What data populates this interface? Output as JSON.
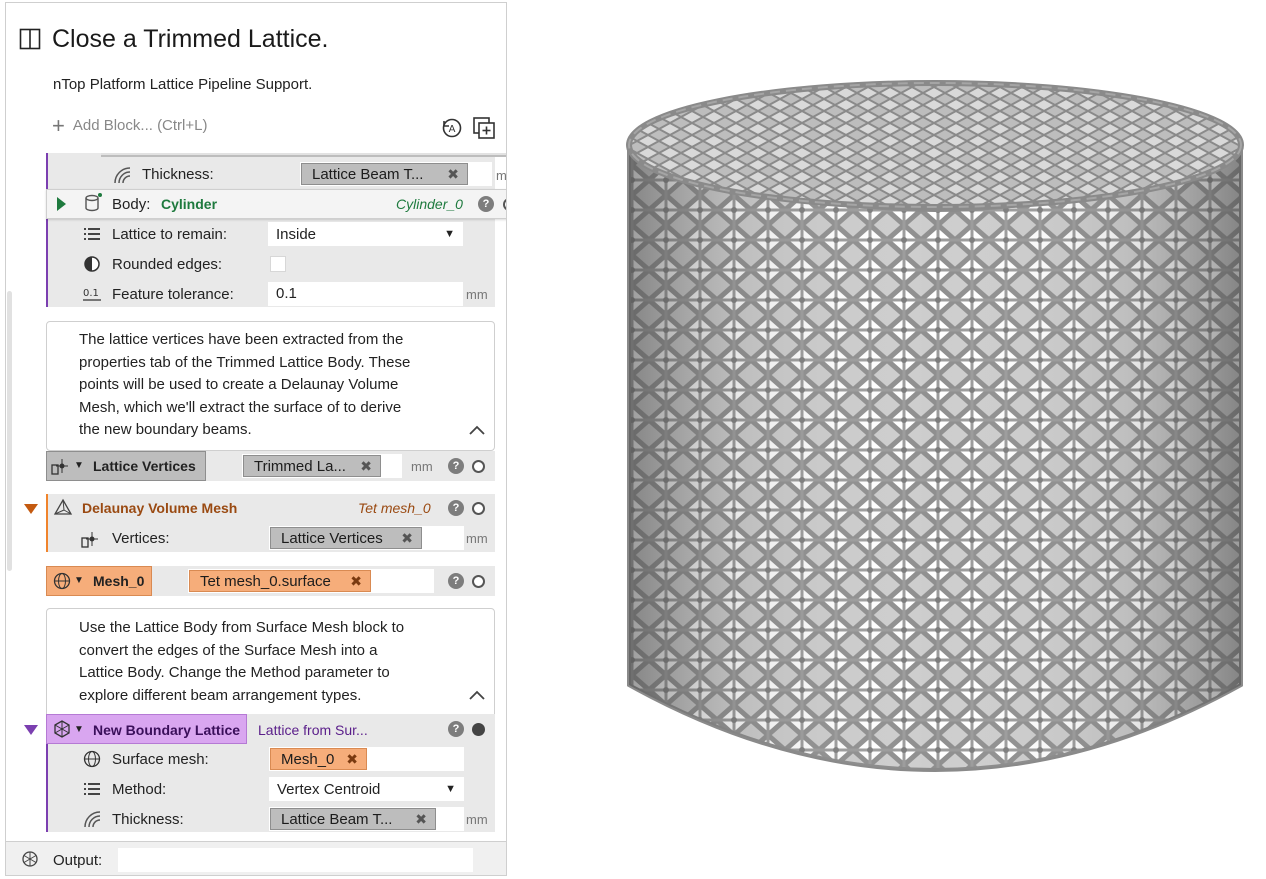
{
  "panel": {
    "title": "Close a Trimmed Lattice.",
    "subtitle": "nTop Platform Lattice Pipeline Support.",
    "add_block": "Add Block... (Ctrl+L)"
  },
  "trim_block": {
    "thickness_label": "Thickness:",
    "thickness_value": "Lattice Beam T...",
    "thickness_unit": "mm",
    "body_label": "Body:",
    "body_value": "Cylinder",
    "body_ref": "Cylinder_0",
    "remain_label": "Lattice to remain:",
    "remain_value": "Inside",
    "rounded_label": "Rounded edges:",
    "tolerance_label": "Feature tolerance:",
    "tolerance_value": "0.1",
    "tolerance_unit": "mm"
  },
  "note1": {
    "lines": [
      "The lattice vertices have been extracted from the",
      "properties tab of the Trimmed Lattice Body. These",
      "points will be used to create a Delaunay Volume",
      "Mesh, which we'll extract the surface of to derive",
      "the new boundary beams."
    ]
  },
  "lattice_vertices": {
    "name": "Lattice Vertices",
    "value": "Trimmed La...",
    "unit": "mm"
  },
  "delaunay": {
    "name": "Delaunay Volume Mesh",
    "ref": "Tet mesh_0",
    "vertices_label": "Vertices:",
    "vertices_value": "Lattice Vertices",
    "unit": "mm"
  },
  "mesh0": {
    "name": "Mesh_0",
    "value": "Tet mesh_0.surface"
  },
  "note2": {
    "lines": [
      "Use the Lattice Body from Surface Mesh block to",
      "convert the edges of the Surface Mesh into a",
      "Lattice Body. Change the Method parameter to",
      "explore different beam arrangement types."
    ]
  },
  "boundary": {
    "name": "New Boundary Lattice",
    "ref": "Lattice from Sur...",
    "surface_label": "Surface mesh:",
    "surface_value": "Mesh_0",
    "method_label": "Method:",
    "method_value": "Vertex Centroid",
    "thickness_label": "Thickness:",
    "thickness_value": "Lattice Beam T...",
    "unit": "mm"
  },
  "output": {
    "label": "Output:"
  },
  "colors": {
    "green": "#1e7a3e",
    "orange": "#f6ad7a",
    "orange_text": "#9a4a12",
    "purple": "#7b3fb0",
    "purple_bg": "#d9a6f0",
    "lattice": "#9a9a9a"
  }
}
